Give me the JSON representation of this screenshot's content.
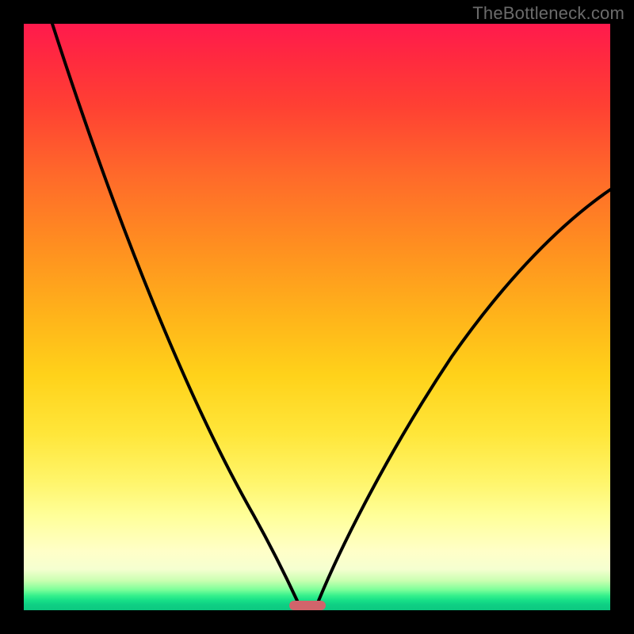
{
  "watermark": "TheBottleneck.com",
  "chart_data": {
    "type": "line",
    "title": "",
    "xlabel": "",
    "ylabel": "",
    "xlim": [
      0,
      100
    ],
    "ylim": [
      0,
      100
    ],
    "grid": false,
    "legend": false,
    "background_gradient": {
      "stops": [
        {
          "pos": 0.0,
          "color": "#ff1a4d"
        },
        {
          "pos": 0.5,
          "color": "#ffb41a"
        },
        {
          "pos": 0.9,
          "color": "#ffffc8"
        },
        {
          "pos": 0.97,
          "color": "#36f08c"
        },
        {
          "pos": 1.0,
          "color": "#0cc880"
        }
      ]
    },
    "series": [
      {
        "name": "left-curve",
        "x": [
          5,
          10,
          15,
          20,
          25,
          30,
          35,
          40,
          43,
          45,
          46,
          47
        ],
        "y": [
          100,
          88,
          77,
          66,
          55,
          43,
          31,
          18,
          9,
          3,
          1,
          0
        ]
      },
      {
        "name": "right-curve",
        "x": [
          50,
          52,
          55,
          60,
          65,
          70,
          75,
          80,
          85,
          90,
          95,
          100
        ],
        "y": [
          0,
          3,
          9,
          20,
          29,
          37,
          44,
          51,
          57,
          62,
          67,
          72
        ]
      }
    ],
    "marker": {
      "name": "bottleneck-marker",
      "x_center": 48.5,
      "y": 0,
      "width_pct": 6,
      "color": "#d1646b"
    }
  }
}
